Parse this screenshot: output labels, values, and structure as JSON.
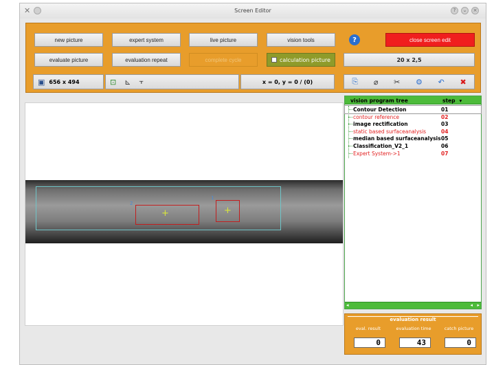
{
  "window": {
    "title": "Screen Editor"
  },
  "toolbar": {
    "new_picture": "new picture",
    "expert_system": "expert system",
    "live_picture": "live picture",
    "vision_tools": "vision tools",
    "close_screen_edit": "close screen edit",
    "evaluate_picture": "evaluate picture",
    "evaluation_repeat": "evaluation repeat",
    "complete_cycle": "complete cycle",
    "calculation_picture": "calculation picture",
    "scale": "20 x 2,5",
    "resolution": "656 x 494",
    "coordinates": "x = 0, y = 0 / (0)"
  },
  "image": {
    "roi_labels": [
      "2",
      "1"
    ]
  },
  "tree": {
    "col_name": "vision program tree",
    "col_step": "step",
    "items": [
      {
        "name": "Contour Detection",
        "step": "01",
        "highlight": false
      },
      {
        "name": "contour reference",
        "step": "02",
        "highlight": true
      },
      {
        "name": "image rectification",
        "step": "03",
        "highlight": false
      },
      {
        "name": "static based surfaceanalysis",
        "step": "04",
        "highlight": true
      },
      {
        "name": "median based surfaceanalysis",
        "step": "05",
        "highlight": false
      },
      {
        "name": "Classification_V2_1",
        "step": "06",
        "highlight": false
      },
      {
        "name": "Expert System->1",
        "step": "07",
        "highlight": true
      }
    ]
  },
  "evaluation": {
    "title": "evaluation result",
    "eval_result_label": "eval. result",
    "eval_time_label": "evaluation time",
    "catch_picture_label": "catch picture",
    "eval_result": "0",
    "eval_time": "43",
    "catch_picture": "0"
  },
  "colors": {
    "toolbar_orange": "#e89d2b",
    "close_red": "#f01e1e",
    "tree_green": "#4dbb3a",
    "highlight_red": "#e22121"
  }
}
